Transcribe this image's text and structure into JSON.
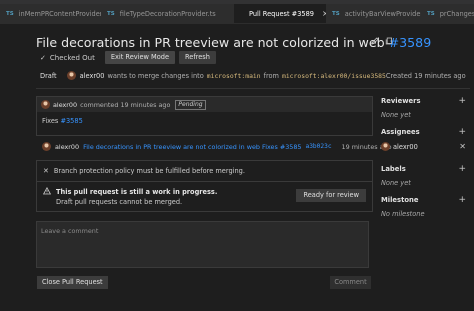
{
  "tabs": [
    {
      "badge": "TS",
      "label": "inMemPRContentProvider.ts",
      "active": false
    },
    {
      "badge": "TS",
      "label": "fileTypeDecorationProvider.ts",
      "active": false
    },
    {
      "badge": "",
      "label": "Pull Request #3589",
      "active": true,
      "close": "×"
    },
    {
      "badge": "TS",
      "label": "activityBarViewProvider.ts",
      "active": false
    },
    {
      "badge": "TS",
      "label": "prChangesT",
      "active": false
    }
  ],
  "header": {
    "title": "File decorations in PR treeview are not colorized in web",
    "number": "#3589",
    "edit_icon": "pencil-icon",
    "copy_icon": "copy-icon"
  },
  "actions": {
    "checked_out": "Checked Out",
    "exit_review": "Exit Review Mode",
    "refresh": "Refresh"
  },
  "meta": {
    "state": "Draft",
    "author": "alexr00",
    "merge_text": "wants to merge changes into",
    "target_branch": "microsoft:main",
    "from_text": "from",
    "source_branch": "microsoft:alexr00/issue3585",
    "created": "Created 19 minutes ago"
  },
  "comment": {
    "author": "alexr00",
    "text": "commented 19 minutes ago",
    "badge": "Pending",
    "body_prefix": "Fixes",
    "body_link": "#3585"
  },
  "commit": {
    "author": "alexr00",
    "message": "File decorations in PR treeview are not colorized in web Fixes #3585",
    "sha": "a3b023c",
    "time": "19 minutes ago"
  },
  "status": {
    "branch_protection": "Branch protection policy must be fulfilled before merging.",
    "wip_title": "This pull request is still a work in progress.",
    "wip_sub": "Draft pull requests cannot be merged.",
    "ready_button": "Ready for review"
  },
  "compose": {
    "placeholder": "Leave a comment",
    "close_button": "Close Pull Request",
    "comment_button": "Comment"
  },
  "sidebar": {
    "reviewers": {
      "label": "Reviewers",
      "value": "None yet"
    },
    "assignees": {
      "label": "Assignees",
      "value": "alexr00"
    },
    "labels": {
      "label": "Labels",
      "value": "None yet"
    },
    "milestone": {
      "label": "Milestone",
      "value": "No milestone"
    }
  }
}
